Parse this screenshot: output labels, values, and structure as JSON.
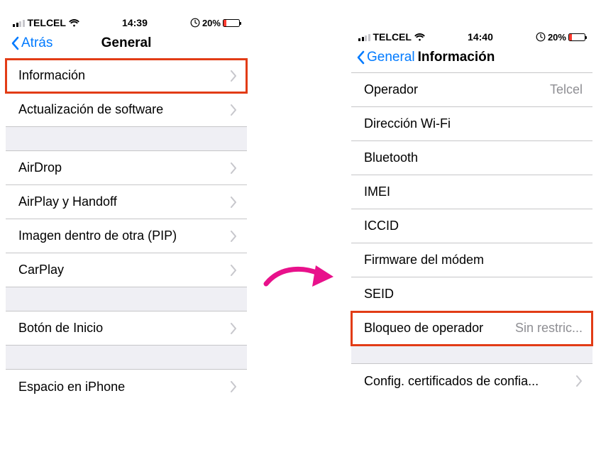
{
  "left": {
    "status": {
      "carrier": "TELCEL",
      "time": "14:39",
      "battery_pct": "20%"
    },
    "nav": {
      "back": "Atrás",
      "title": "General"
    },
    "rows": {
      "info": "Información",
      "software": "Actualización de software",
      "airdrop": "AirDrop",
      "airplay": "AirPlay y Handoff",
      "pip": "Imagen dentro de otra (PIP)",
      "carplay": "CarPlay",
      "home": "Botón de Inicio",
      "storage": "Espacio en iPhone"
    }
  },
  "right": {
    "status": {
      "carrier": "TELCEL",
      "time": "14:40",
      "battery_pct": "20%"
    },
    "nav": {
      "back": "General",
      "title": "Información"
    },
    "rows": {
      "operator_label": "Operador",
      "operator_value": "Telcel",
      "wifi_addr": "Dirección Wi-Fi",
      "bluetooth": "Bluetooth",
      "imei": "IMEI",
      "iccid": "ICCID",
      "modem": "Firmware del módem",
      "seid": "SEID",
      "carrier_lock_label": "Bloqueo de operador",
      "carrier_lock_value": "Sin restric...",
      "certs": "Config. certificados de confia..."
    }
  }
}
